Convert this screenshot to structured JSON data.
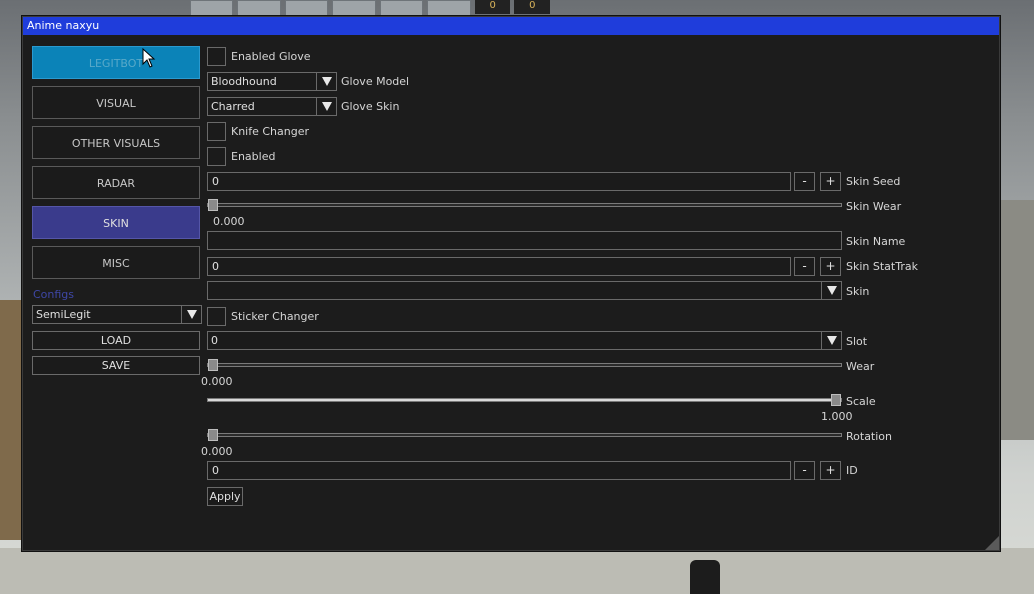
{
  "game": {
    "top_counters": [
      "0",
      "0"
    ]
  },
  "window": {
    "title": "Anime naxyu"
  },
  "nav": {
    "legitbot": "LEGITBOT",
    "visual": "VISUAL",
    "other_visuals": "OTHER VISUALS",
    "radar": "RADAR",
    "skin": "SKIN",
    "misc": "MISC"
  },
  "configs": {
    "label": "Configs",
    "selected": "SemiLegit",
    "load": "LOAD",
    "save": "SAVE"
  },
  "skin_panel": {
    "enabled_glove": "Enabled Glove",
    "glove_model_value": "Bloodhound",
    "glove_model_label": "Glove Model",
    "glove_skin_value": "Charred",
    "glove_skin_label": "Glove Skin",
    "knife_changer": "Knife Changer",
    "enabled": "Enabled",
    "skin_seed_value": "0",
    "skin_seed_label": "Skin Seed",
    "skin_wear_label": "Skin Wear",
    "skin_wear_value": "0.000",
    "skin_name_value": "",
    "skin_name_label": "Skin Name",
    "stattrak_value": "0",
    "stattrak_label": "Skin StatTrak",
    "skin_combo_value": "",
    "skin_label": "Skin",
    "sticker_changer": "Sticker Changer",
    "slot_value": "0",
    "slot_label": "Slot",
    "wear_label": "Wear",
    "wear_value": "0.000",
    "scale_label": "Scale",
    "scale_value": "1.000",
    "rotation_label": "Rotation",
    "rotation_value": "0.000",
    "id_value": "0",
    "id_label": "ID",
    "minus": "-",
    "plus": "+",
    "apply": "Apply"
  },
  "colors": {
    "titlebar": "#1f3ddb",
    "legitbot_active": "#0b83b8",
    "skin_active": "#3a3b8c",
    "configs_label": "#3e47a6"
  }
}
